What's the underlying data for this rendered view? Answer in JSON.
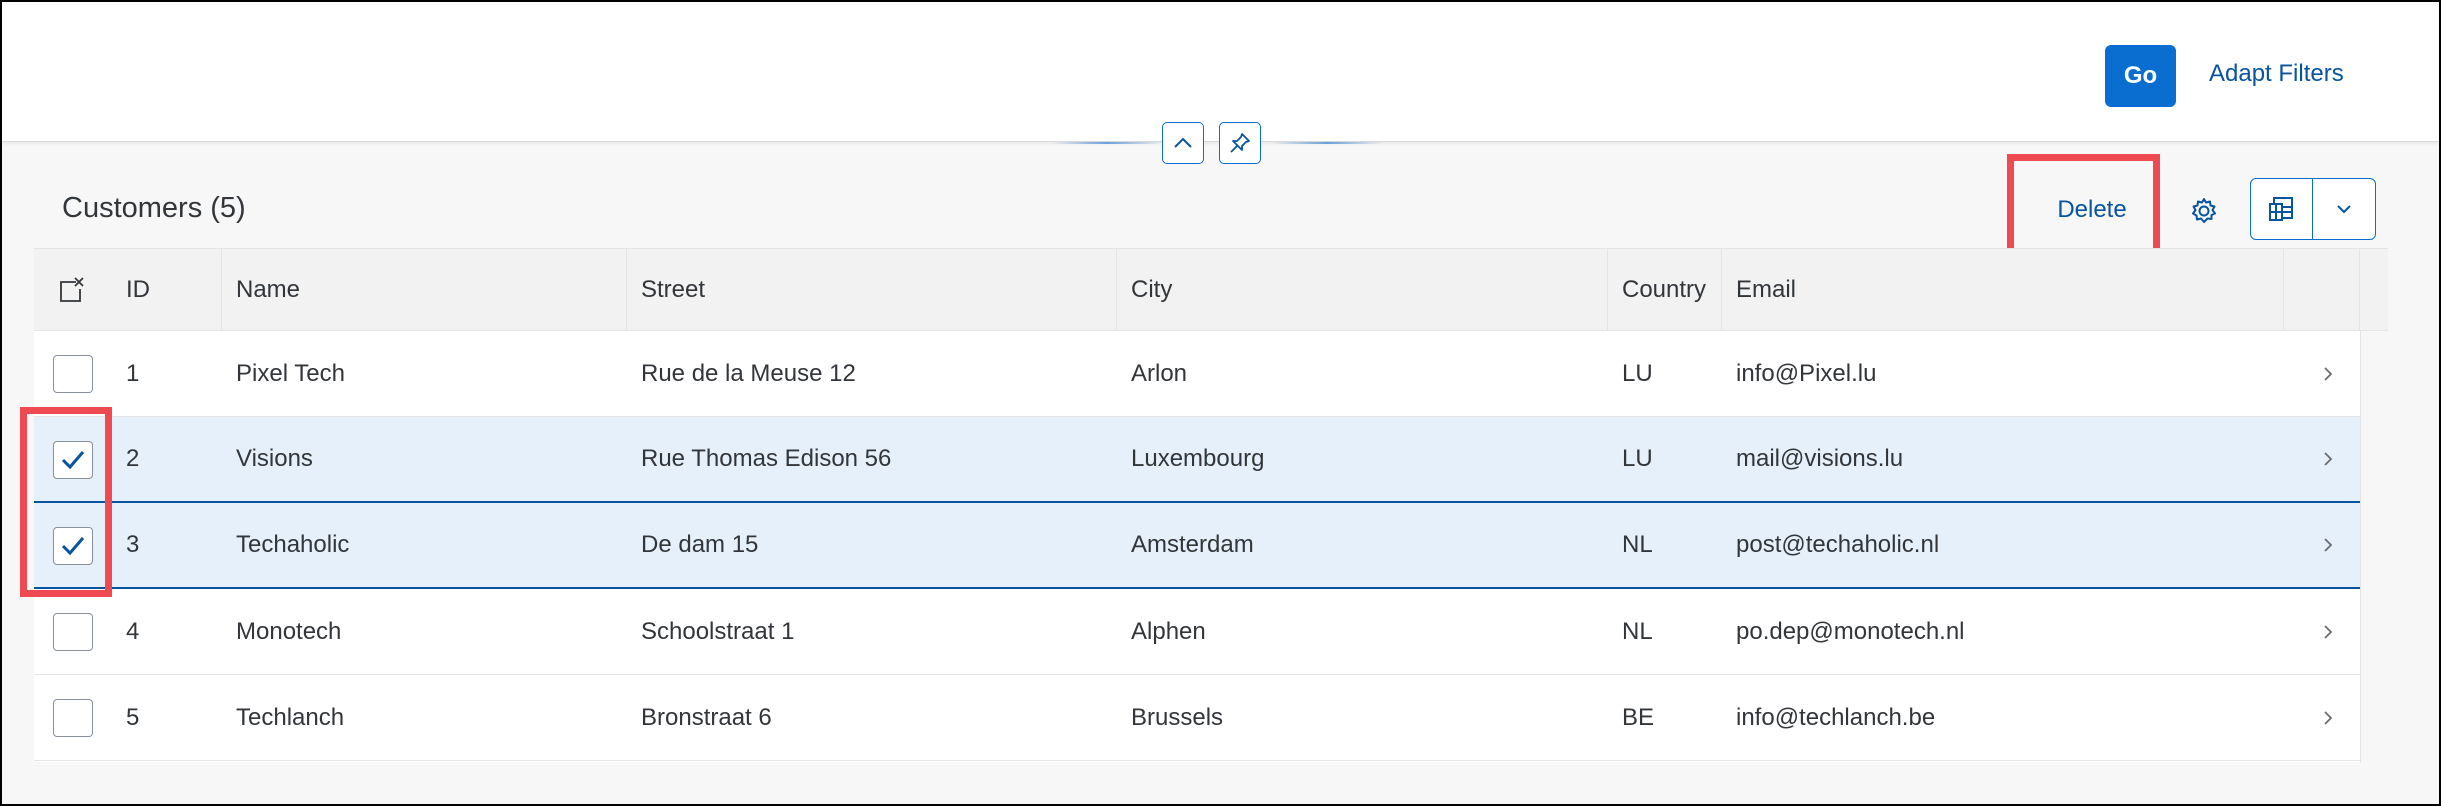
{
  "filterbar": {
    "go_label": "Go",
    "adapt_filters_label": "Adapt Filters"
  },
  "table": {
    "title": "Customers (5)",
    "delete_label": "Delete",
    "columns": [
      "ID",
      "Name",
      "Street",
      "City",
      "Country",
      "Email"
    ],
    "rows": [
      {
        "selected": false,
        "id": "1",
        "name": "Pixel Tech",
        "street": "Rue de la Meuse 12",
        "city": "Arlon",
        "country": "LU",
        "email": "info@Pixel.lu"
      },
      {
        "selected": true,
        "id": "2",
        "name": "Visions",
        "street": "Rue Thomas Edison 56",
        "city": "Luxembourg",
        "country": "LU",
        "email": "mail@visions.lu"
      },
      {
        "selected": true,
        "id": "3",
        "name": "Techaholic",
        "street": "De dam 15",
        "city": "Amsterdam",
        "country": "NL",
        "email": "post@techaholic.nl"
      },
      {
        "selected": false,
        "id": "4",
        "name": "Monotech",
        "street": "Schoolstraat 1",
        "city": "Alphen",
        "country": "NL",
        "email": "po.dep@monotech.nl"
      },
      {
        "selected": false,
        "id": "5",
        "name": "Techlanch",
        "street": "Bronstraat 6",
        "city": "Brussels",
        "country": "BE",
        "email": "info@techlanch.be"
      }
    ]
  },
  "colors": {
    "accent": "#0a6ed1",
    "link": "#0854a0",
    "selected_row": "#e5f0fa",
    "highlight": "#ef4a52"
  },
  "icons": {
    "collapse": "chevron-up-icon",
    "pin": "pin-icon",
    "settings": "gear-icon",
    "export": "spreadsheet-export-icon",
    "export_menu": "chevron-down-icon",
    "clear_selection": "clear-selection-icon",
    "row_nav": "chevron-right-icon",
    "check": "checkmark-icon"
  }
}
